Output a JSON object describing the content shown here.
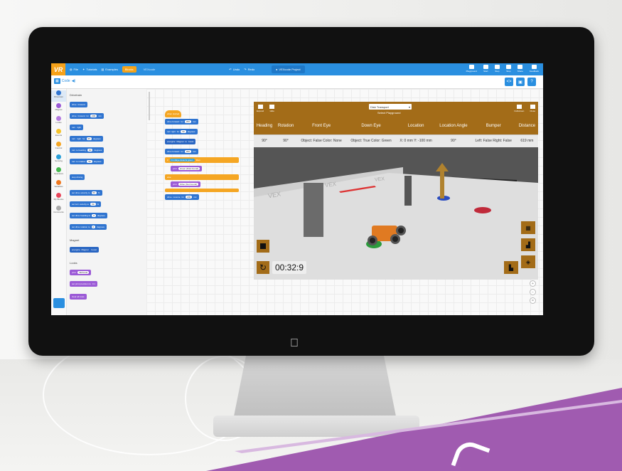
{
  "topbar": {
    "logo": "VR",
    "items": [
      "File",
      "Tutorials",
      "Examples"
    ],
    "blocks_tab": "Blocks",
    "text_tab": "VEXcode",
    "undo_label": "Undo",
    "redo_label": "Redo",
    "project_name": "VEXcode Project",
    "right_items": [
      "Playground",
      "Start",
      "Step",
      "Stop",
      "Share",
      "Feedback"
    ]
  },
  "subbar": {
    "code_label": "Code"
  },
  "categories": [
    {
      "label": "Drivetrain",
      "color": "#2f74d0"
    },
    {
      "label": "Magnet",
      "color": "#9b5ad6"
    },
    {
      "label": "Looks",
      "color": "#b57be0"
    },
    {
      "label": "Events",
      "color": "#f5c32a"
    },
    {
      "label": "Control",
      "color": "#f5a623"
    },
    {
      "label": "Sensing",
      "color": "#2a9fd8"
    },
    {
      "label": "Operators",
      "color": "#44b84d"
    },
    {
      "label": "Variables",
      "color": "#f0781e"
    },
    {
      "label": "My Blocks",
      "color": "#e8455a"
    },
    {
      "label": "Comments",
      "color": "#aaaaaa"
    }
  ],
  "flyout": {
    "drivetrain_header": "Drivetrain",
    "magnet_header": "Magnet",
    "looks_header": "Looks",
    "blocks": {
      "drive": "drive",
      "forward": "forward",
      "for": "for",
      "mm": "mm",
      "turn": "turn",
      "right": "right",
      "degrees": "degrees",
      "turn_heading": "turn to heading",
      "turn_rotation": "turn to rotation",
      "stop_driving": "stop driving",
      "set_drive_vel": "set drive velocity to",
      "set_turn_vel": "set turn velocity to",
      "set_drive_heading": "set drive heading to",
      "set_drive_rotation": "set drive rotation to",
      "energize": "energize",
      "magnet": "Magnet",
      "boost": "boost",
      "print": "print",
      "print_value": "VEXcode",
      "set_print_precision": "set print precision to",
      "clear_all_rows": "clear all rows",
      "n200": "200",
      "n90": "90",
      "n50": "50",
      "n0": "0",
      "pct": "%",
      "precision": "0.1"
    }
  },
  "script": {
    "when_started": "when started",
    "drive_forward": "drive forward",
    "turn_right": "turn right",
    "energize": "energize",
    "magnet": "Magnet",
    "boost": "boost",
    "frontEye": "FrontEye",
    "detects": "detects",
    "green": "green",
    "then": "then",
    "print1": "Green (Disk Found)",
    "print2": "Other (Not Found)",
    "v_for": "for",
    "v_200": "200",
    "v_90": "90",
    "v_mm": "mm",
    "v_degrees": "degrees",
    "v_to": "to",
    "v_if": "if",
    "v_else": "else",
    "v_print": "print",
    "v_drive": "drive",
    "v_reverse": "reverse"
  },
  "playground": {
    "left_tools": [
      "Expand",
      "Hide"
    ],
    "right_tools": [
      "Fullscreen",
      "Close"
    ],
    "select_value": "Disk Transport",
    "select_caption": "Select Playground",
    "table": {
      "headers": [
        "Heading",
        "Rotation",
        "Front Eye",
        "Down Eye",
        "Location",
        "Location Angle",
        "Bumper",
        "Distance"
      ],
      "row": [
        "90°",
        "90°",
        "Object: False Color: None",
        "Object: True Color: Green",
        "X: 0 mm Y: -100 mm",
        "90°",
        "Left: False Right: False",
        "619 mm"
      ]
    },
    "timer": "00:32:9",
    "reset_icon": "↻",
    "arena_text": [
      "VEX",
      "VEX",
      "VEX"
    ]
  },
  "colors": {
    "accent_blue": "#2a8fe0",
    "playground_gold": "#a36c18",
    "banner_purple": "#a05bb0"
  }
}
